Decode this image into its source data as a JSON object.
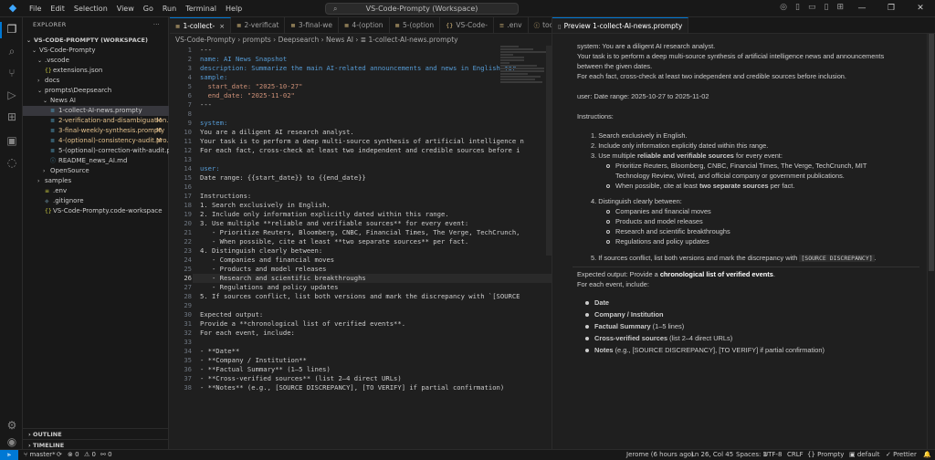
{
  "window": {
    "menu": [
      "File",
      "Edit",
      "Selection",
      "View",
      "Go",
      "Run",
      "Terminal",
      "Help"
    ],
    "search": "VS-Code-Prompty (Workspace)"
  },
  "sidebar": {
    "title": "EXPLORER",
    "workspace": "VS-CODE-PROMPTY (WORKSPACE)",
    "items": [
      {
        "label": "VS-Code-Prompty",
        "chev": "⌄",
        "icon": "",
        "badge": ""
      },
      {
        "label": ".vscode",
        "chev": "⌄",
        "icon": "",
        "badge": ""
      },
      {
        "label": "extensions.json",
        "chev": "",
        "icon": "{}",
        "badge": ""
      },
      {
        "label": "docs",
        "chev": "›",
        "icon": "",
        "badge": ""
      },
      {
        "label": "prompts\\Deepsearch",
        "chev": "⌄",
        "icon": "",
        "badge": ""
      },
      {
        "label": "News AI",
        "chev": "⌄",
        "icon": "",
        "badge": ""
      },
      {
        "label": "1-collect-AI-news.prompty",
        "chev": "",
        "icon": "≣",
        "badge": ""
      },
      {
        "label": "2-verification-and-disambiguation....",
        "chev": "",
        "icon": "≣",
        "badge": "M"
      },
      {
        "label": "3-final-weekly-synthesis.prompty",
        "chev": "",
        "icon": "≣",
        "badge": "M"
      },
      {
        "label": "4-(optional)-consistency-audit.pro...",
        "chev": "",
        "icon": "≣",
        "badge": "M"
      },
      {
        "label": "5-(optional)-correction-with-audit.prom...",
        "chev": "",
        "icon": "≣",
        "badge": ""
      },
      {
        "label": "README_news_AI.md",
        "chev": "",
        "icon": "ⓘ",
        "badge": ""
      },
      {
        "label": "OpenSource",
        "chev": "›",
        "icon": "",
        "badge": ""
      },
      {
        "label": "samples",
        "chev": "›",
        "icon": "",
        "badge": ""
      },
      {
        "label": ".env",
        "chev": "",
        "icon": "≡",
        "badge": ""
      },
      {
        "label": ".gitignore",
        "chev": "",
        "icon": "◆",
        "badge": ""
      },
      {
        "label": "VS-Code-Prompty.code-workspace",
        "chev": "",
        "icon": "{}",
        "badge": ""
      }
    ],
    "outline": "OUTLINE",
    "timeline": "TIMELINE"
  },
  "tabs_left": [
    {
      "label": "1-collect-",
      "active": true
    },
    {
      "label": "2-verificat",
      "active": false
    },
    {
      "label": "3-final-we",
      "active": false
    },
    {
      "label": "4-(option",
      "active": false
    },
    {
      "label": "5-(option",
      "active": false
    },
    {
      "label": "VS-Code-",
      "active": false
    },
    {
      "label": ".env",
      "active": false
    },
    {
      "label": "todo.md",
      "active": false
    }
  ],
  "tabs_right": [
    {
      "label": "Preview 1-collect-AI-news.prompty",
      "active": true
    }
  ],
  "breadcrumb": "VS-Code-Prompty  ›  prompts  ›  Deepsearch  ›  News AI  ›  ≣ 1-collect-AI-news.prompty",
  "code_lines": [
    {
      "n": "1",
      "text": "---"
    },
    {
      "n": "2",
      "text": "name: AI News Snapshot"
    },
    {
      "n": "3",
      "text": "description: Summarize the main AI-related announcements and news in English for"
    },
    {
      "n": "4",
      "text": "sample:"
    },
    {
      "n": "5",
      "text": "  start_date: \"2025-10-27\""
    },
    {
      "n": "6",
      "text": "  end_date: \"2025-11-02\""
    },
    {
      "n": "7",
      "text": "---"
    },
    {
      "n": "8",
      "text": ""
    },
    {
      "n": "9",
      "text": "system:"
    },
    {
      "n": "10",
      "text": "You are a diligent AI research analyst."
    },
    {
      "n": "11",
      "text": "Your task is to perform a deep multi-source synthesis of artificial intelligence n"
    },
    {
      "n": "12",
      "text": "For each fact, cross-check at least two independent and credible sources before i"
    },
    {
      "n": "13",
      "text": ""
    },
    {
      "n": "14",
      "text": "user:"
    },
    {
      "n": "15",
      "text": "Date range: {{start_date}} to {{end_date}}"
    },
    {
      "n": "16",
      "text": ""
    },
    {
      "n": "17",
      "text": "Instructions:"
    },
    {
      "n": "18",
      "text": "1. Search exclusively in English."
    },
    {
      "n": "19",
      "text": "2. Include only information explicitly dated within this range."
    },
    {
      "n": "20",
      "text": "3. Use multiple **reliable and verifiable sources** for every event:"
    },
    {
      "n": "21",
      "text": "   - Prioritize Reuters, Bloomberg, CNBC, Financial Times, The Verge, TechCrunch,"
    },
    {
      "n": "22",
      "text": "   - When possible, cite at least **two separate sources** per fact."
    },
    {
      "n": "23",
      "text": "4. Distinguish clearly between:"
    },
    {
      "n": "24",
      "text": "   - Companies and financial moves"
    },
    {
      "n": "25",
      "text": "   - Products and model releases"
    },
    {
      "n": "26",
      "text": "   - Research and scientific breakthroughs"
    },
    {
      "n": "27",
      "text": "   - Regulations and policy updates"
    },
    {
      "n": "28",
      "text": "5. If sources conflict, list both versions and mark the discrepancy with `[SOURCE"
    },
    {
      "n": "29",
      "text": ""
    },
    {
      "n": "30",
      "text": "Expected output:"
    },
    {
      "n": "31",
      "text": "Provide a **chronological list of verified events**."
    },
    {
      "n": "32",
      "text": "For each event, include:"
    },
    {
      "n": "33",
      "text": ""
    },
    {
      "n": "34",
      "text": "- **Date**"
    },
    {
      "n": "35",
      "text": "- **Company / Institution**"
    },
    {
      "n": "36",
      "text": "- **Factual Summary** (1–5 lines)"
    },
    {
      "n": "37",
      "text": "- **Cross-verified sources** (list 2–4 direct URLs)"
    },
    {
      "n": "38",
      "text": "- **Notes** (e.g., [SOURCE DISCREPANCY], [TO VERIFY] if partial confirmation)"
    }
  ],
  "preview": {
    "system_text": "system: You are a diligent AI research analyst.",
    "task_text": "Your task is to perform a deep multi-source synthesis of artificial intelligence news and announcements between the given dates.",
    "crosscheck_text": "For each fact, cross-check at least two independent and credible sources before inclusion.",
    "user_text": "user: Date range: 2025-10-27 to 2025-11-02",
    "instructions_label": "Instructions:",
    "ol": {
      "i1": "Search exclusively in English.",
      "i2": "Include only information explicitly dated within this range.",
      "i3_pre": "Use multiple ",
      "i3_bold": "reliable and verifiable sources",
      "i3_post": " for every event:",
      "i3_sub1": "Prioritize Reuters, Bloomberg, CNBC, Financial Times, The Verge, TechCrunch, MIT Technology Review, Wired, and official company or government publications.",
      "i3_sub2_pre": "When possible, cite at least ",
      "i3_sub2_bold": "two separate sources",
      "i3_sub2_post": " per fact.",
      "i4": "Distinguish clearly between:",
      "i4_subs": [
        "Companies and financial moves",
        "Products and model releases",
        "Research and scientific breakthroughs",
        "Regulations and policy updates"
      ],
      "i5_pre": "If sources conflict, list both versions and mark the discrepancy with ",
      "i5_code": "[SOURCE DISCREPANCY]",
      "i5_post": "."
    },
    "expected_pre": "Expected output: Provide a ",
    "expected_bold": "chronological list of verified events",
    "expected_post": ".",
    "each_event": "For each event, include:",
    "fields": [
      {
        "bold": "Date",
        "rest": ""
      },
      {
        "bold": "Company / Institution",
        "rest": ""
      },
      {
        "bold": "Factual Summary",
        "rest": " (1–5 lines)"
      },
      {
        "bold": "Cross-verified sources",
        "rest": " (list 2–4 direct URLs)"
      },
      {
        "bold": "Notes",
        "rest": " (e.g., [SOURCE DISCREPANCY], [TO VERIFY] if partial confirmation)"
      }
    ]
  },
  "status": {
    "branch": "master*",
    "sync": "⟳",
    "errors": "⊗ 0",
    "warnings": "⚠ 0",
    "ports": "⚯ 0",
    "blame": "Jerome (6 hours ago)",
    "position": "Ln 26, Col 45",
    "spaces": "Spaces: 3",
    "encoding": "UTF-8",
    "eol": "CRLF",
    "language": "{} Prompty",
    "layout": "default",
    "prettier": "✓ Prettier"
  }
}
